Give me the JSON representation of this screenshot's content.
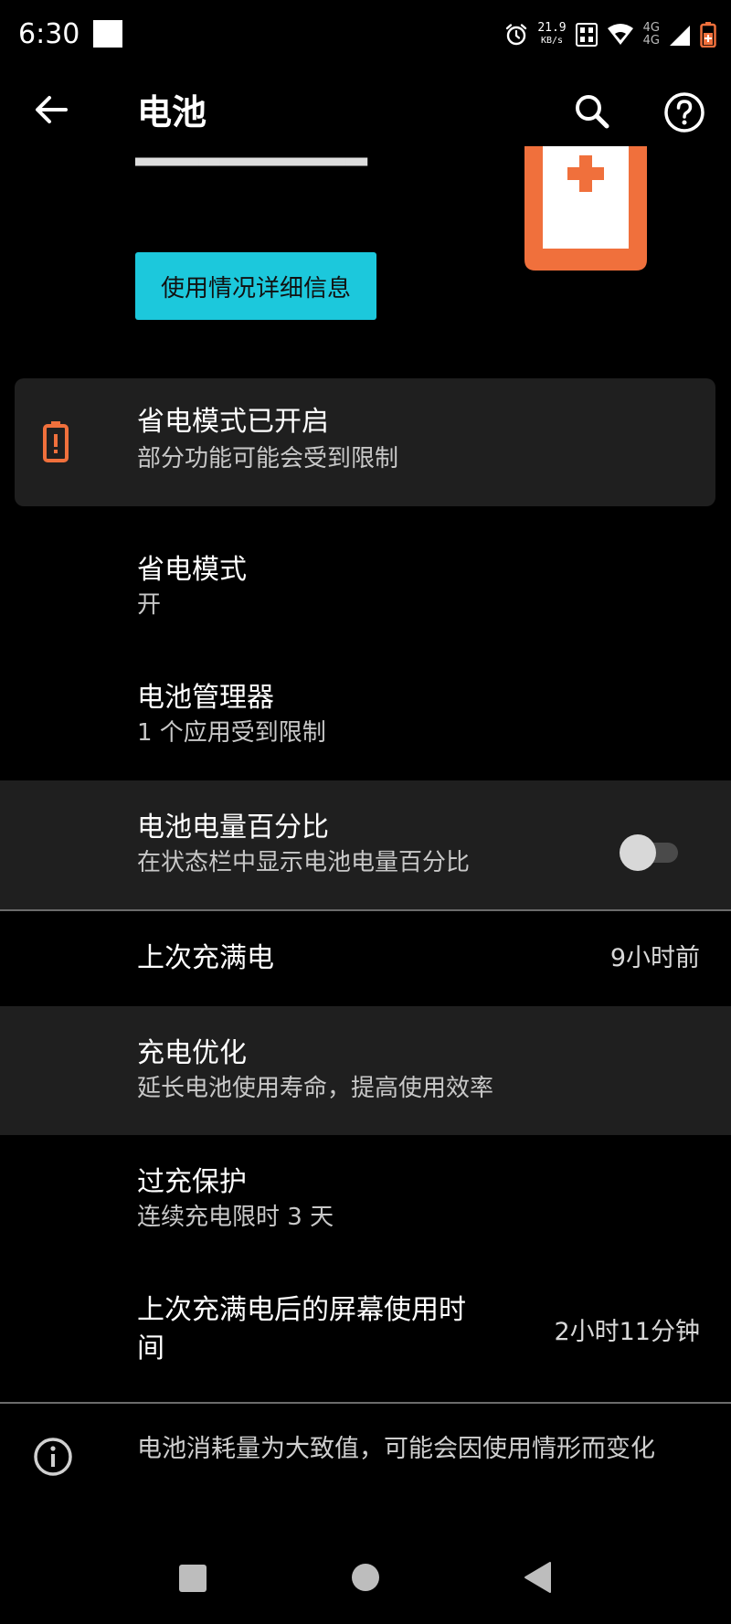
{
  "status_bar": {
    "time": "6:30",
    "net_speed_value": "21.9",
    "net_speed_unit": "KB/s",
    "signal_label_top": "4G",
    "signal_label_bottom": "4G"
  },
  "app_bar": {
    "title": "电池"
  },
  "header": {
    "details_button_label": "使用情况详细信息"
  },
  "banner": {
    "title": "省电模式已开启",
    "subtitle": "部分功能可能会受到限制"
  },
  "settings": {
    "power_saving": {
      "title": "省电模式",
      "subtitle": "开"
    },
    "battery_manager": {
      "title": "电池管理器",
      "subtitle": "1 个应用受到限制"
    },
    "battery_percentage": {
      "title": "电池电量百分比",
      "subtitle": "在状态栏中显示电池电量百分比",
      "enabled": false
    },
    "last_full_charge": {
      "title": "上次充满电",
      "value": "9小时前"
    },
    "charging_optimization": {
      "title": "充电优化",
      "subtitle": "延长电池使用寿命，提高使用效率"
    },
    "overcharge_protection": {
      "title": "过充保护",
      "subtitle": "连续充电限时 3 天"
    },
    "screen_usage": {
      "title_line1": "上次充满电后的屏幕使用时",
      "title_line2": "间",
      "value": "2小时11分钟"
    }
  },
  "footnote": "电池消耗量为大致值，可能会因使用情形而变化",
  "colors": {
    "accent_button": "#1cc8dc",
    "battery_orange": "#f0703c",
    "background": "#000000",
    "highlight_row": "#1f1f1f"
  },
  "icons": [
    "back-arrow-icon",
    "search-icon",
    "help-icon",
    "battery-saver-icon",
    "info-icon",
    "alarm-icon",
    "wifi-icon",
    "signal-icon",
    "battery-status-icon"
  ]
}
